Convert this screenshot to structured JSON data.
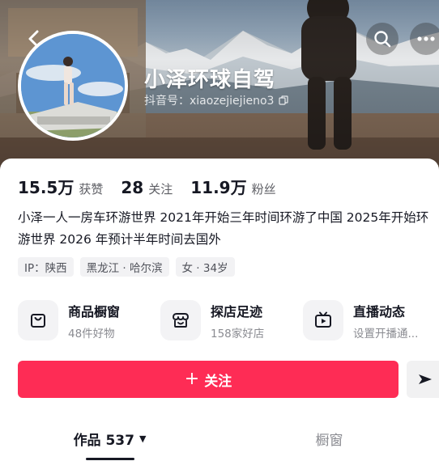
{
  "profile": {
    "nickname": "小泽环球自驾",
    "douyin_id": "抖音号：xiaozejiejieno3"
  },
  "stats": [
    {
      "value": "15.5万",
      "label": "获赞"
    },
    {
      "value": "28",
      "label": "关注"
    },
    {
      "value": "11.9万",
      "label": "粉丝"
    }
  ],
  "bio": "小泽一人一房车环游世界 2021年开始三年时间环游了中国 2025年开始环游世界 2026 年预计半年时间去国外",
  "tags": [
    "IP：陕西",
    "黑龙江 · 哈尔滨",
    "女 · 34岁"
  ],
  "features": [
    {
      "title": "商品橱窗",
      "subtitle": "48件好物",
      "icon": "shopping-bag-icon"
    },
    {
      "title": "探店足迹",
      "subtitle": "158家好店",
      "icon": "store-icon"
    },
    {
      "title": "直播动态",
      "subtitle": "设置开播通...",
      "icon": "tv-icon"
    }
  ],
  "follow_button": {
    "plus": "+",
    "label": "关注"
  },
  "tabs": {
    "works": {
      "label": "作品 537",
      "caret": "▼"
    },
    "window": {
      "label": "橱窗"
    }
  },
  "colors": {
    "accent": "#fe2c55",
    "text_primary": "#161823",
    "text_secondary": "#8a8b91"
  }
}
